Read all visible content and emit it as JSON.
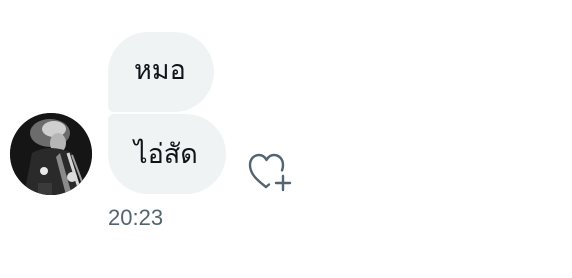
{
  "conversation": {
    "sender": {
      "avatar_icon": "user-avatar-photo"
    },
    "messages": [
      {
        "text": "หมอ"
      },
      {
        "text": "ไอ่สัด"
      }
    ],
    "timestamp": "20:23",
    "reaction_icon": "heart-plus-icon"
  },
  "colors": {
    "bubble_bg": "#eff3f4",
    "text": "#0f1419",
    "muted": "#536471"
  }
}
